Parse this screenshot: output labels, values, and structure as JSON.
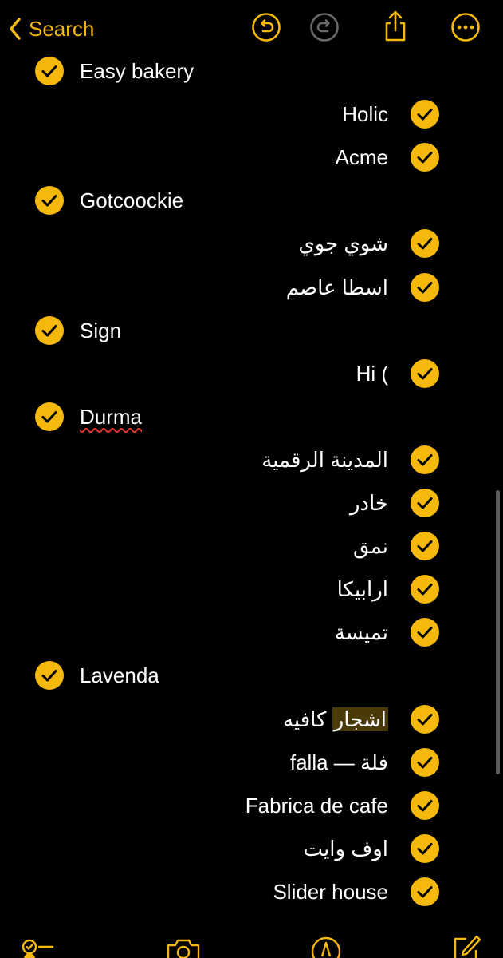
{
  "nav": {
    "back_label": "Search",
    "icons": [
      "chevron-left-icon",
      "undo-icon",
      "redo-icon",
      "share-icon",
      "more-icon"
    ]
  },
  "colors": {
    "accent": "#f5b80c",
    "background": "#000000",
    "text": "#ffffff",
    "highlight": "#4a3a08"
  },
  "items": [
    {
      "text": "Easy bakery",
      "level": 1,
      "checked": true
    },
    {
      "text": "Holic",
      "level": 2,
      "checked": true
    },
    {
      "text": "Acme",
      "level": 2,
      "checked": true
    },
    {
      "text": "Gotcoockie",
      "level": 1,
      "checked": true
    },
    {
      "text": "شوي جوي",
      "level": 2,
      "checked": true
    },
    {
      "text": "اسطا عاصم",
      "level": 2,
      "checked": true
    },
    {
      "text": "Sign",
      "level": 1,
      "checked": true
    },
    {
      "text": "Hi (",
      "level": 2,
      "checked": true
    },
    {
      "text": "Durma",
      "level": 1,
      "checked": true,
      "misspelled": true
    },
    {
      "text": "المدينة الرقمية",
      "level": 2,
      "checked": true
    },
    {
      "text": "خادر",
      "level": 2,
      "checked": true
    },
    {
      "text": "نمق",
      "level": 2,
      "checked": true
    },
    {
      "text": "ارابيكا",
      "level": 2,
      "checked": true
    },
    {
      "text": "تميسة",
      "level": 2,
      "checked": true
    },
    {
      "text": "Lavenda",
      "level": 1,
      "checked": true
    },
    {
      "text": "اشجار كافيه",
      "level": 2,
      "checked": true,
      "highlight": "اشجار"
    },
    {
      "text": "falla — فلة",
      "level": 2,
      "checked": true
    },
    {
      "text": "Fabrica de cafe",
      "level": 2,
      "checked": true
    },
    {
      "text": "اوف وايت",
      "level": 2,
      "checked": true
    },
    {
      "text": "Slider house",
      "level": 2,
      "checked": true
    }
  ],
  "toolbar": {
    "icons": [
      "checklist-icon",
      "camera-icon",
      "markup-pen-icon",
      "compose-icon"
    ]
  }
}
